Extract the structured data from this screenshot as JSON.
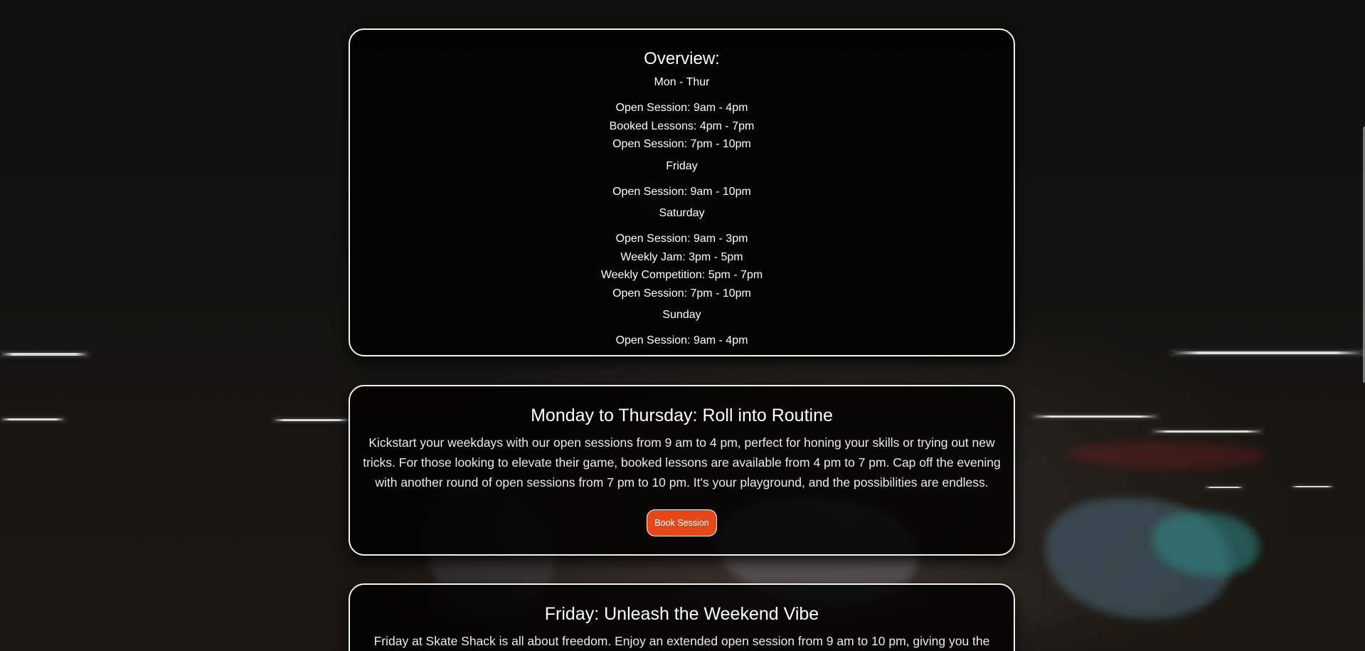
{
  "colors": {
    "card_border": "#f2f2f2",
    "card_background": "#000000",
    "button_accent": "#e4471a",
    "text": "#ffffff"
  },
  "overview": {
    "title": "Overview:",
    "days": [
      {
        "day": "Mon - Thur",
        "lines": [
          "Open Session: 9am - 4pm",
          "Booked Lessons: 4pm - 7pm",
          "Open Session: 7pm - 10pm"
        ]
      },
      {
        "day": "Friday",
        "lines": [
          "Open Session: 9am - 10pm"
        ]
      },
      {
        "day": "Saturday",
        "lines": [
          "Open Session: 9am - 3pm",
          "Weekly Jam: 3pm - 5pm",
          "Weekly Competition: 5pm - 7pm",
          "Open Session: 7pm - 10pm"
        ]
      },
      {
        "day": "Sunday",
        "lines": [
          "Open Session: 9am - 4pm"
        ]
      }
    ]
  },
  "monday_thursday": {
    "title": "Monday to Thursday: Roll into Routine",
    "text": "Kickstart your weekdays with our open sessions from 9 am to 4 pm, perfect for honing your skills or trying out new tricks. For those looking to elevate their game, booked lessons are available from 4 pm to 7 pm. Cap off the evening with another round of open sessions from 7 pm to 10 pm. It's your playground, and the possibilities are endless.",
    "button_label": "Book Session"
  },
  "friday": {
    "title": "Friday: Unleash the Weekend Vibe",
    "text": "Friday at Skate Shack is all about freedom. Enjoy an extended open session from 9 am to 10 pm, giving you the"
  }
}
